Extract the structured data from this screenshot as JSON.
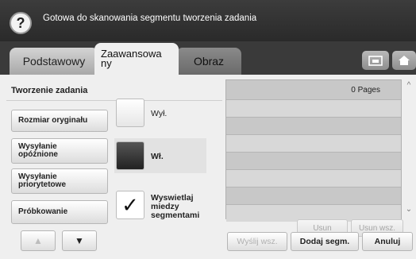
{
  "header": {
    "status": "Gotowa do skanowania segmentu tworzenia zadania",
    "help_icon": "question-mark-icon"
  },
  "tabs": [
    {
      "label": "Podstawowy",
      "active": false
    },
    {
      "label": "Zaawansowa\nny",
      "active": true
    },
    {
      "label": "Obraz",
      "active": false
    }
  ],
  "toolbar_icons": [
    "job-status-icon",
    "home-icon"
  ],
  "section": {
    "title": "Tworzenie zadania"
  },
  "side_menu": [
    {
      "label": "Rozmiar oryginału"
    },
    {
      "label": "Wysyłanie\nopóźnione"
    },
    {
      "label": "Wysyłanie\npriorytetowe"
    },
    {
      "label": "Próbkowanie"
    }
  ],
  "options": {
    "off_label": "Wył.",
    "on_label": "Wł.",
    "selected": "Wł.",
    "show_between_label": "Wyswietlaj\nmiedzy\nsegmentami",
    "show_between_checked": true,
    "check_glyph": "✓"
  },
  "pages_list": {
    "header": "0 Pages",
    "rows": 7,
    "remove_label": "Usun",
    "remove_all_label": "Usun wsz."
  },
  "nav": {
    "up_glyph": "▲",
    "down_glyph": "▼"
  },
  "actions": {
    "send_all_label": "Wyślij wsz.",
    "add_segment_label": "Dodaj segm.",
    "cancel_label": "Anuluj"
  },
  "colors": {
    "header_bg": "#2f2f2f",
    "panel_bg": "#efefef",
    "selected_box": "#333333"
  }
}
